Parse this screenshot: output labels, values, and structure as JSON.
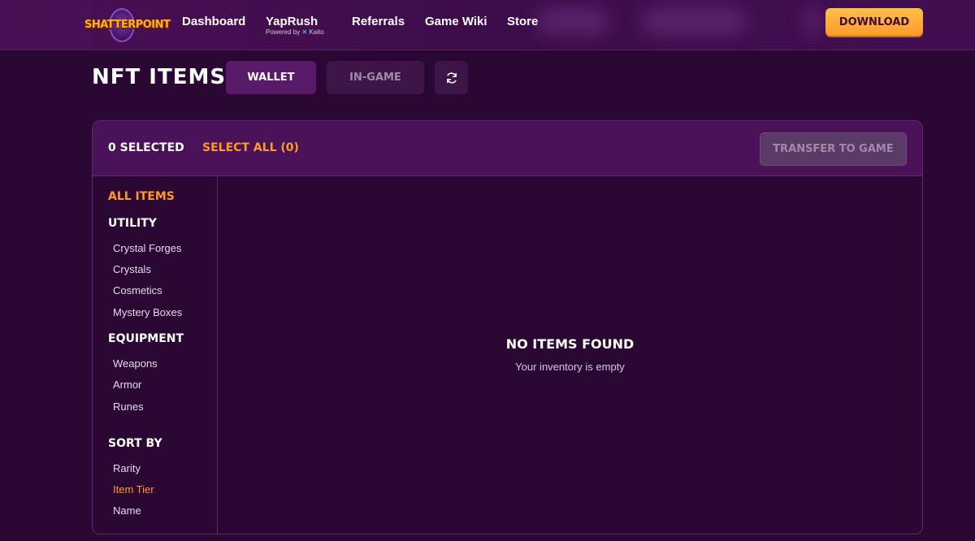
{
  "nav": {
    "logo_text": "SHATTERPOINT",
    "links": [
      "Dashboard",
      "YapRush",
      "Referrals",
      "Game Wiki",
      "Store"
    ],
    "yaprush_sub": "Powered by",
    "yaprush_sub_brand": "Kaito",
    "download_label": "DOWNLOAD"
  },
  "header": {
    "title": "NFT ITEMS",
    "tab_wallet": "WALLET",
    "tab_ingame": "IN-GAME",
    "refresh_icon": "refresh-icon"
  },
  "panel": {
    "selected": "0 SELECTED",
    "select_all": "SELECT ALL (0)",
    "transfer_label": "TRANSFER TO GAME"
  },
  "sidebar": {
    "all_items": "ALL ITEMS",
    "utility": "UTILITY",
    "utility_items": [
      "Crystal Forges",
      "Crystals",
      "Cosmetics",
      "Mystery Boxes"
    ],
    "equipment": "EQUIPMENT",
    "equipment_items": [
      "Weapons",
      "Armor",
      "Runes"
    ],
    "sort_by": "SORT BY",
    "sort_items": [
      "Rarity",
      "Item Tier",
      "Name"
    ]
  },
  "empty": {
    "title": "NO ITEMS FOUND",
    "subtitle": "Your inventory is empty"
  },
  "colors": {
    "accent_orange": "#ff9a2a",
    "background": "#2a0833",
    "panel_header": "#4a1258"
  }
}
